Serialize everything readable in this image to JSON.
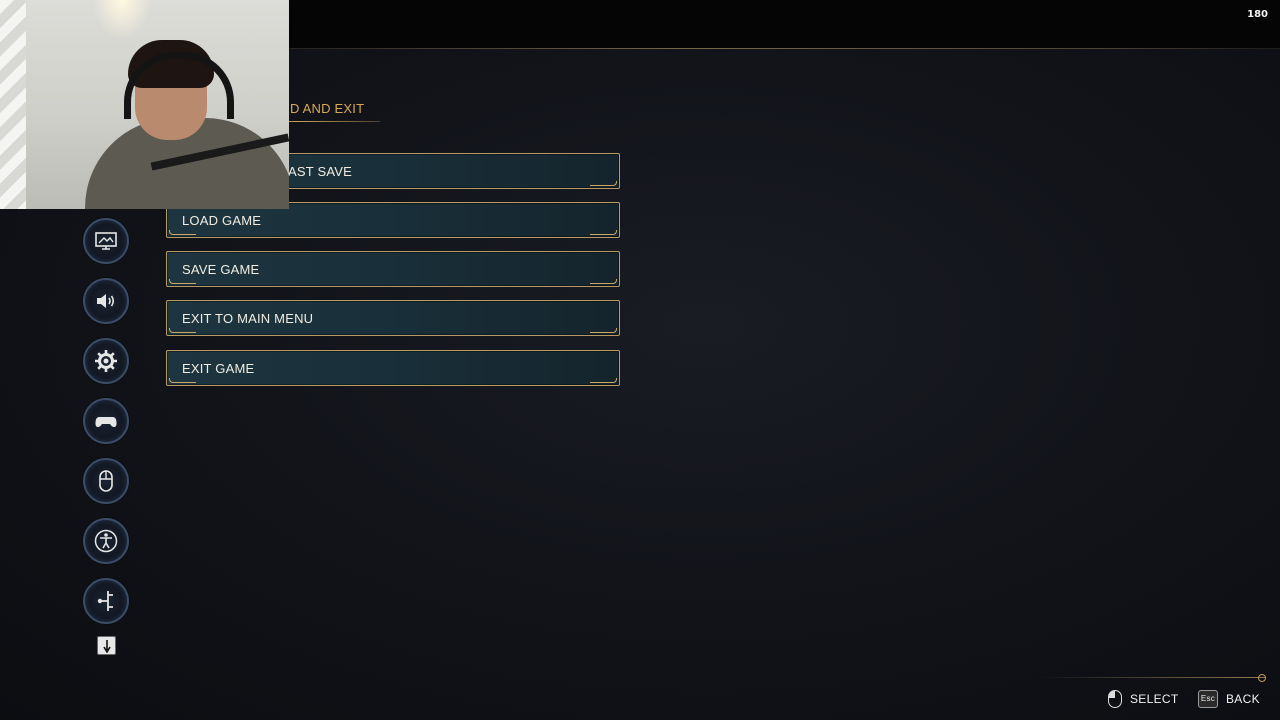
{
  "overlay": {
    "fps_counter": "180"
  },
  "menu": {
    "title": "D AND EXIT",
    "buttons": [
      {
        "label": "AST SAVE"
      },
      {
        "label": "LOAD GAME"
      },
      {
        "label": "SAVE GAME"
      },
      {
        "label": "EXIT TO MAIN MENU"
      },
      {
        "label": "EXIT GAME"
      }
    ]
  },
  "sidebar": {
    "icons": [
      {
        "name": "display-icon"
      },
      {
        "name": "audio-icon"
      },
      {
        "name": "gameplay-gear-icon"
      },
      {
        "name": "controller-icon"
      },
      {
        "name": "mouse-icon"
      },
      {
        "name": "accessibility-icon"
      },
      {
        "name": "network-icon"
      }
    ],
    "scroll_icon": "arrow-down-icon"
  },
  "footer": {
    "select_label": "SELECT",
    "back_key": "Esc",
    "back_label": "BACK"
  },
  "colors": {
    "accent_gold": "#d8a94e",
    "button_bg": "#1e3540",
    "button_border": "#b89a64",
    "icon_ring": "#3a4c66"
  }
}
